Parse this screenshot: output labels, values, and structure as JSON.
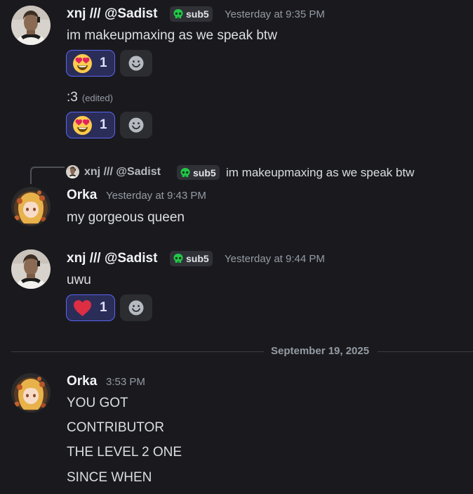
{
  "colors": {
    "accent": "#5865f2",
    "background": "#1a1a1e",
    "skull": "#23c74a"
  },
  "messages": [
    {
      "author": "xnj /// @Sadist",
      "tag": "sub5",
      "timestamp": "Yesterday at 9:35 PM",
      "lines": [
        {
          "text": "im makeupmaxing as we speak btw",
          "reaction": {
            "emoji": "heart-eyes-emoji",
            "count": "1"
          }
        },
        {
          "text": ":3",
          "edited": "(edited)",
          "reaction": {
            "emoji": "heart-eyes-emoji",
            "count": "1"
          }
        }
      ]
    },
    {
      "reply": {
        "author": "xnj /// @Sadist",
        "tag": "sub5",
        "text": "im makeupmaxing as we speak btw"
      },
      "author": "Orka",
      "timestamp": "Yesterday at 9:43 PM",
      "lines": [
        {
          "text": "my gorgeous queen"
        }
      ]
    },
    {
      "author": "xnj /// @Sadist",
      "tag": "sub5",
      "timestamp": "Yesterday at 9:44 PM",
      "lines": [
        {
          "text": "uwu",
          "reaction": {
            "emoji": "red-heart-emoji",
            "count": "1"
          }
        }
      ]
    }
  ],
  "divider": {
    "date": "September 19, 2025"
  },
  "last_message": {
    "author": "Orka",
    "timestamp": "3:53 PM",
    "lines": [
      "YOU GOT",
      "CONTRIBUTOR",
      "THE LEVEL 2 ONE",
      "SINCE WHEN"
    ]
  }
}
